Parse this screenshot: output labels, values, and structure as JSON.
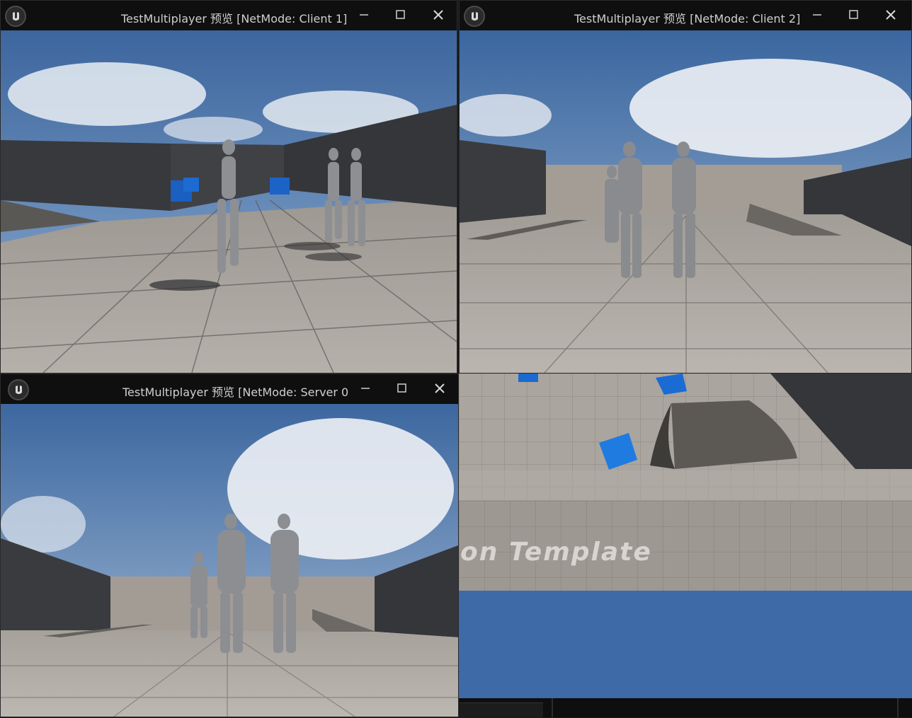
{
  "windows": [
    {
      "id": "client1",
      "title": "TestMultiplayer 预览 [NetMode: Client 1]"
    },
    {
      "id": "client2",
      "title": "TestMultiplayer 预览 [NetMode: Client 2]"
    },
    {
      "id": "server",
      "title": "TestMultiplayer 预览 [NetMode: Server 0"
    }
  ],
  "editor_viewport": {
    "template_text": "on Template"
  },
  "colors": {
    "titlebar_bg": "#0f0f0f",
    "sky_top": "#3f6aa3",
    "sky_bottom": "#a9bfd8",
    "floor": "#a8a39d",
    "wall": "#3a3c40",
    "cube_blue": "#1a6fd0",
    "editor_blue_floor": "#3f6aa8"
  },
  "icons": [
    "unreal-logo-icon",
    "minimize-icon",
    "maximize-icon",
    "close-icon"
  ]
}
